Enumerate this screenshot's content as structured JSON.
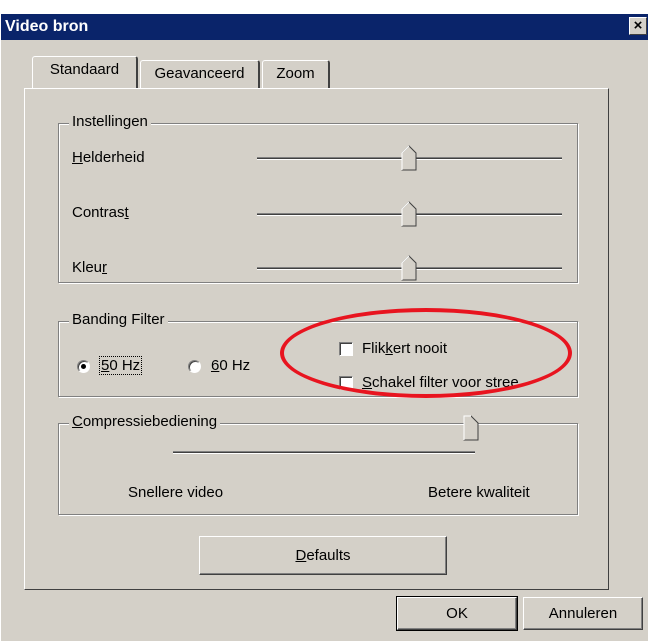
{
  "window": {
    "title": "Video bron",
    "close_glyph": "×"
  },
  "tabs": [
    {
      "label": "Standaard",
      "active": true
    },
    {
      "label": "Geavanceerd",
      "active": false
    },
    {
      "label": "Zoom",
      "active": false
    }
  ],
  "instellingen": {
    "legend": "Instellingen",
    "sliders": [
      {
        "label_pre": "",
        "label_ul": "H",
        "label_post": "elderheid",
        "level_percent": 50
      },
      {
        "label_pre": "Contras",
        "label_ul": "t",
        "label_post": "",
        "level_percent": 50
      },
      {
        "label_pre": "Kleu",
        "label_ul": "r",
        "label_post": "",
        "level_percent": 50
      }
    ]
  },
  "banding": {
    "legend": "Banding Filter",
    "radio_50": {
      "ul": "5",
      "rest": "0 Hz",
      "checked": true
    },
    "radio_60": {
      "ul": "6",
      "rest": "0 Hz",
      "checked": false
    },
    "check_flikker": {
      "pre": "Flik",
      "ul": "k",
      "post": "ert nooit",
      "checked": false
    },
    "check_schakel": {
      "pre": "",
      "ul": "S",
      "post": "chakel filter voor stree",
      "checked": false
    }
  },
  "compressie": {
    "legend_ul": "C",
    "legend_rest": "ompressiebediening",
    "left_label": "Snellere video",
    "right_label": "Betere kwaliteit",
    "level_percent": 100
  },
  "buttons": {
    "defaults": {
      "ul": "D",
      "rest": "efaults"
    },
    "ok": "OK",
    "cancel": "Annuleren"
  },
  "annotation_color": "#e8141f"
}
